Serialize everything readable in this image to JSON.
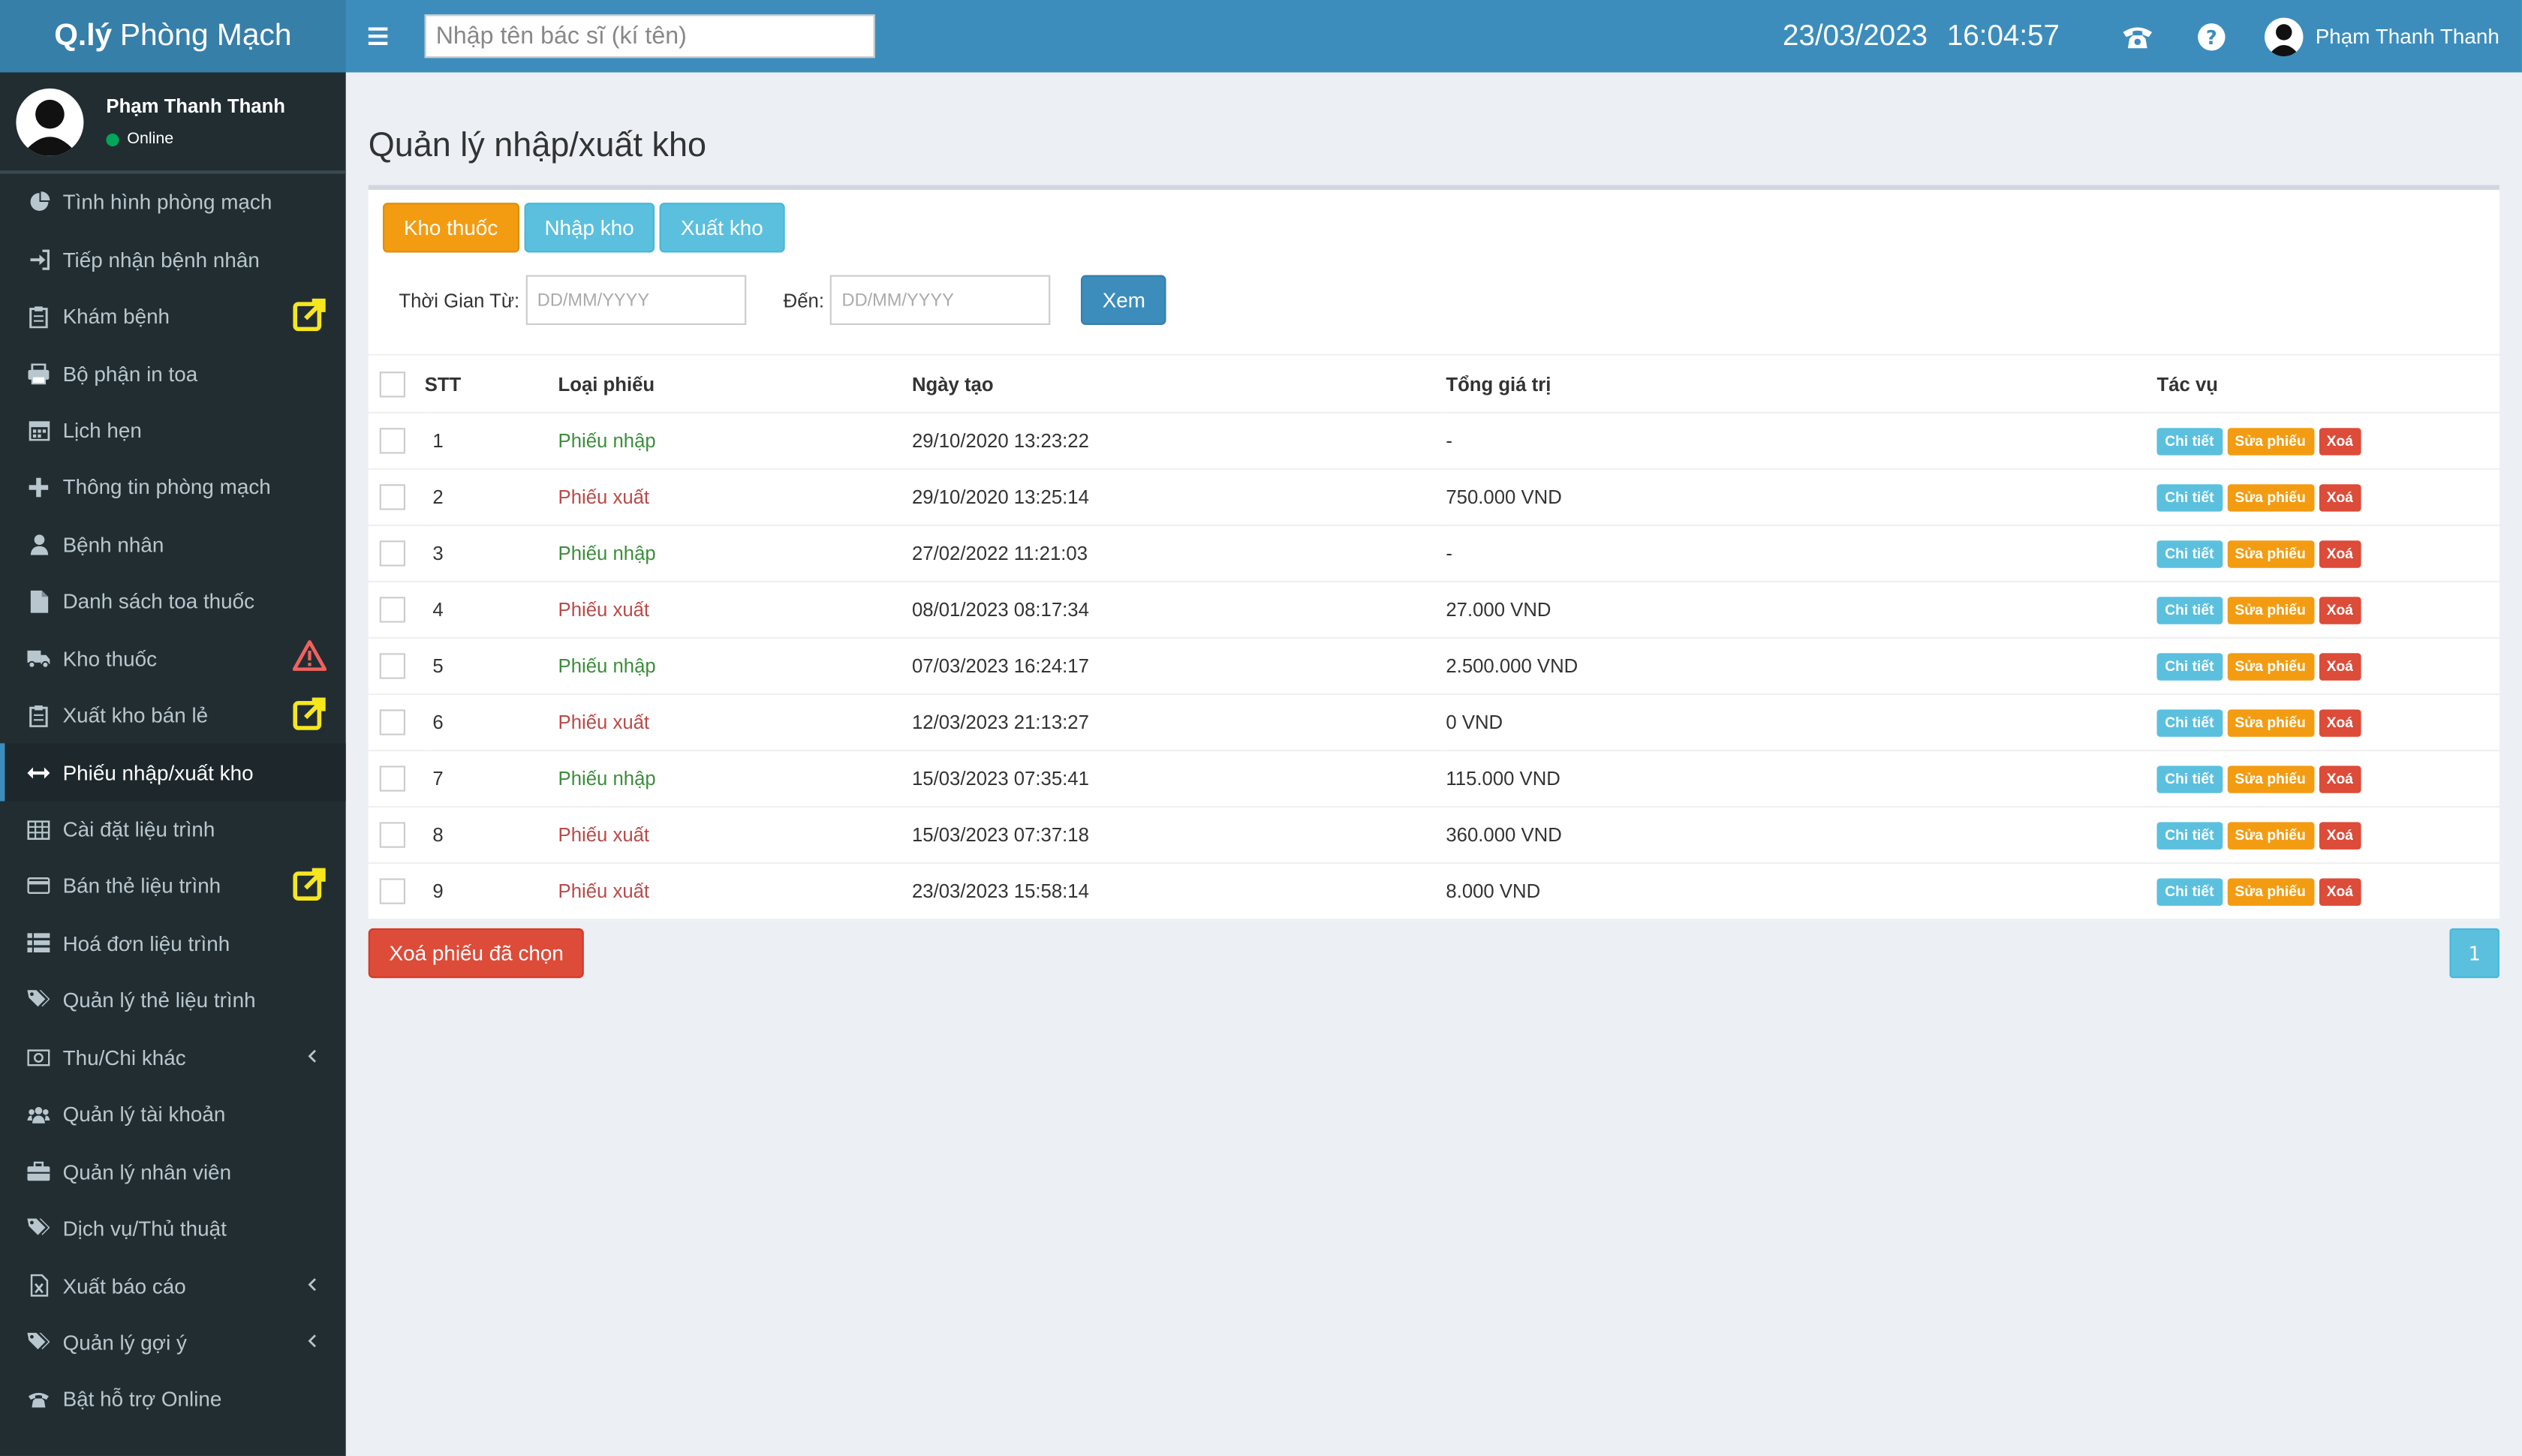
{
  "header": {
    "logo_bold": "Q.lý",
    "logo_light": "Phòng Mạch",
    "search_placeholder": "Nhập tên bác sĩ (kí tên)",
    "date": "23/03/2023",
    "time": "16:04:57",
    "user": "Phạm Thanh Thanh"
  },
  "sidebar": {
    "user_name": "Phạm Thanh Thanh",
    "status": "Online",
    "items": [
      {
        "label": "Tình hình phòng mạch",
        "icon": "pie-chart-icon"
      },
      {
        "label": "Tiếp nhận bệnh nhân",
        "icon": "sign-in-icon"
      },
      {
        "label": "Khám bệnh",
        "icon": "clipboard-icon",
        "badge": "external-link-icon"
      },
      {
        "label": "Bộ phận in toa",
        "icon": "print-icon"
      },
      {
        "label": "Lịch hẹn",
        "icon": "calendar-icon"
      },
      {
        "label": "Thông tin phòng mạch",
        "icon": "plus-icon"
      },
      {
        "label": "Bệnh nhân",
        "icon": "user-icon"
      },
      {
        "label": "Danh sách toa thuốc",
        "icon": "file-icon"
      },
      {
        "label": "Kho thuốc",
        "icon": "truck-icon",
        "badge": "warning-icon"
      },
      {
        "label": "Xuất kho bán lẻ",
        "icon": "clipboard-icon",
        "badge": "external-link-icon"
      },
      {
        "label": "Phiếu nhập/xuất kho",
        "icon": "exchange-icon",
        "active": true
      },
      {
        "label": "Cài đặt liệu trình",
        "icon": "table-icon"
      },
      {
        "label": "Bán thẻ liệu trình",
        "icon": "credit-card-icon",
        "badge": "external-link-icon"
      },
      {
        "label": "Hoá đơn liệu trình",
        "icon": "list-icon"
      },
      {
        "label": "Quản lý thẻ liệu trình",
        "icon": "tags-icon"
      },
      {
        "label": "Thu/Chi khác",
        "icon": "money-icon",
        "chevron": true
      },
      {
        "label": "Quản lý tài khoản",
        "icon": "users-icon"
      },
      {
        "label": "Quản lý nhân viên",
        "icon": "briefcase-icon"
      },
      {
        "label": "Dịch vụ/Thủ thuật",
        "icon": "tags-icon"
      },
      {
        "label": "Xuất báo cáo",
        "icon": "excel-file-icon",
        "chevron": true
      },
      {
        "label": "Quản lý gợi ý",
        "icon": "tags-icon",
        "chevron": true
      },
      {
        "label": "Bật hỗ trợ Online",
        "icon": "phone-icon"
      }
    ]
  },
  "main": {
    "title": "Quản lý nhập/xuất kho",
    "buttons": {
      "kho": "Kho thuốc",
      "nhap": "Nhập kho",
      "xuat": "Xuất kho"
    },
    "filter": {
      "from_label": "Thời Gian Từ:",
      "to_label": "Đến:",
      "placeholder": "DD/MM/YYYY",
      "view": "Xem"
    },
    "columns": {
      "stt": "STT",
      "type": "Loại phiếu",
      "date": "Ngày tạo",
      "total": "Tổng giá trị",
      "actions": "Tác vụ"
    },
    "actions": {
      "detail": "Chi tiết",
      "edit": "Sửa phiếu",
      "delete": "Xoá"
    },
    "rows": [
      {
        "stt": "1",
        "type": "Phiếu nhập",
        "kind": "nhap",
        "date": "29/10/2020 13:23:22",
        "total": "-"
      },
      {
        "stt": "2",
        "type": "Phiếu xuất",
        "kind": "xuat",
        "date": "29/10/2020 13:25:14",
        "total": "750.000 VND"
      },
      {
        "stt": "3",
        "type": "Phiếu nhập",
        "kind": "nhap",
        "date": "27/02/2022 11:21:03",
        "total": "-"
      },
      {
        "stt": "4",
        "type": "Phiếu xuất",
        "kind": "xuat",
        "date": "08/01/2023 08:17:34",
        "total": "27.000 VND"
      },
      {
        "stt": "5",
        "type": "Phiếu nhập",
        "kind": "nhap",
        "date": "07/03/2023 16:24:17",
        "total": "2.500.000 VND"
      },
      {
        "stt": "6",
        "type": "Phiếu xuất",
        "kind": "xuat",
        "date": "12/03/2023 21:13:27",
        "total": "0 VND"
      },
      {
        "stt": "7",
        "type": "Phiếu nhập",
        "kind": "nhap",
        "date": "15/03/2023 07:35:41",
        "total": "115.000 VND"
      },
      {
        "stt": "8",
        "type": "Phiếu xuất",
        "kind": "xuat",
        "date": "15/03/2023 07:37:18",
        "total": "360.000 VND"
      },
      {
        "stt": "9",
        "type": "Phiếu xuất",
        "kind": "xuat",
        "date": "23/03/2023 15:58:14",
        "total": "8.000 VND"
      }
    ],
    "delete_selected": "Xoá phiếu đã chọn",
    "page": "1"
  },
  "colors": {
    "header": "#3c8dbc",
    "sidebar": "#222d32",
    "warning": "#f39c12",
    "info": "#5bc0de",
    "danger": "#dd4b39"
  }
}
